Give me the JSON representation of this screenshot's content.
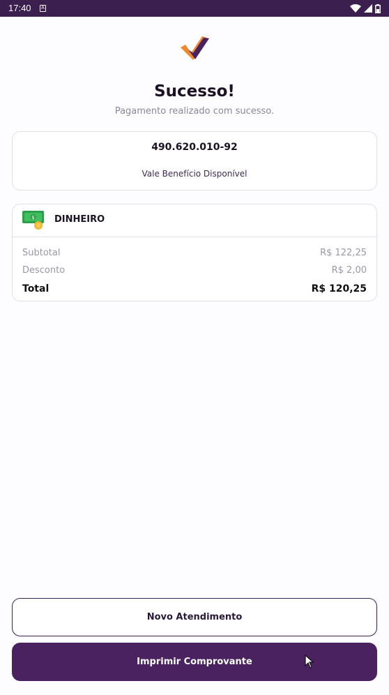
{
  "status_bar": {
    "time": "17:40",
    "a_icon_letter": "A"
  },
  "header": {
    "title": "Sucesso!",
    "subtitle": "Pagamento realizado com sucesso."
  },
  "customer_card": {
    "document": "490.620.010-92",
    "benefit": "Vale Benefício Disponível"
  },
  "payment_card": {
    "method": "DINHEIRO",
    "method_icon": "cash-money-icon",
    "rows": [
      {
        "label": "Subtotal",
        "value": "R$ 122,25"
      },
      {
        "label": "Desconto",
        "value": "R$ 2,00"
      }
    ],
    "total": {
      "label": "Total",
      "value": "R$ 120,25"
    }
  },
  "actions": {
    "new_service": "Novo Atendimento",
    "print_receipt": "Imprimir Comprovante"
  },
  "colors": {
    "brand_purple": "#4a2260",
    "brand_orange": "#f0892c",
    "status_bar": "#3b1f4f"
  }
}
